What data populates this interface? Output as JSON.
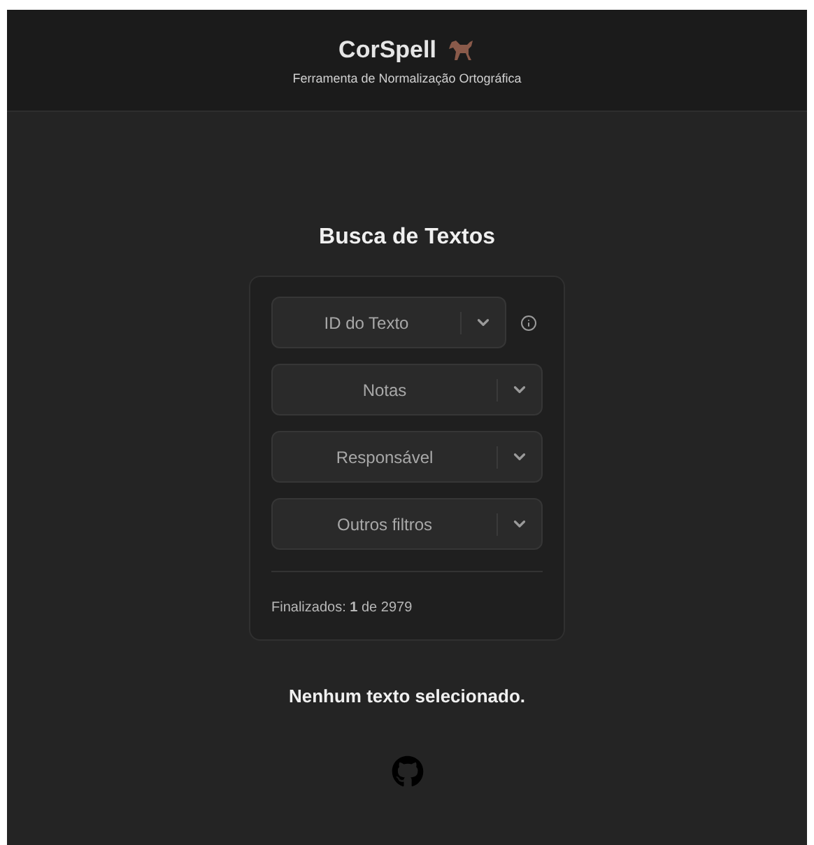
{
  "header": {
    "title": "CorSpell",
    "subtitle": "Ferramenta de Normalização Ortográfica"
  },
  "search": {
    "title": "Busca de Textos",
    "filters": [
      {
        "label": "ID do Texto",
        "info": true
      },
      {
        "label": "Notas",
        "info": false
      },
      {
        "label": "Responsável",
        "info": false
      },
      {
        "label": "Outros filtros",
        "info": false
      }
    ],
    "status": "Finalizados: **1** de 2979"
  },
  "message": "Nenhum texto selecionado."
}
